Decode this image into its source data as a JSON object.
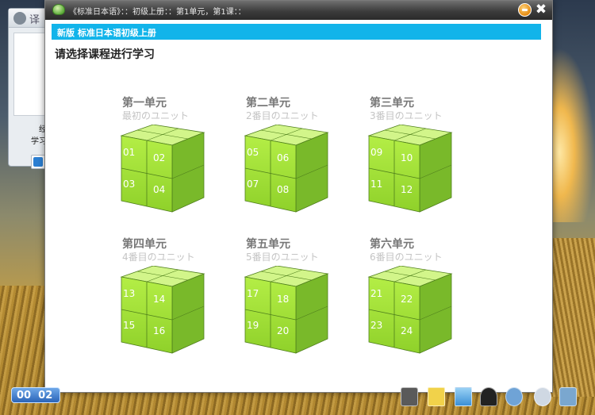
{
  "window": {
    "title": "《标准日本语》：：初级上册：：第1单元，第1课：："
  },
  "background_window": {
    "title": "译",
    "line1": "经验值",
    "line2": "学习进度",
    "button_label": "我"
  },
  "banner": "新版 标准日本语初级上册",
  "prompt": "请选择课程进行学习",
  "units": [
    {
      "title": "第一单元",
      "subtitle": "最初のユニット",
      "lessons": [
        "01",
        "02",
        "03",
        "04"
      ]
    },
    {
      "title": "第二单元",
      "subtitle": "2番目のユニット",
      "lessons": [
        "05",
        "06",
        "07",
        "08"
      ]
    },
    {
      "title": "第三单元",
      "subtitle": "3番目のユニット",
      "lessons": [
        "09",
        "10",
        "11",
        "12"
      ]
    },
    {
      "title": "第四单元",
      "subtitle": "4番目のユニット",
      "lessons": [
        "13",
        "14",
        "15",
        "16"
      ]
    },
    {
      "title": "第五单元",
      "subtitle": "5番目のユニット",
      "lessons": [
        "17",
        "18",
        "19",
        "20"
      ]
    },
    {
      "title": "第六单元",
      "subtitle": "6番目のユニット",
      "lessons": [
        "21",
        "22",
        "23",
        "24"
      ]
    }
  ],
  "taskbar": {
    "clock": "00  02",
    "icons": [
      "binoculars-icon",
      "notes-icon",
      "window-icon",
      "user-icon",
      "cloud-icon",
      "search-icon",
      "phone-icon"
    ]
  },
  "colors": {
    "banner": "#12b4ea",
    "cube_front": "#a9e63a",
    "cube_top": "#d2f58a",
    "cube_side": "#79b92a",
    "cube_edge": "#4f7f1c"
  }
}
